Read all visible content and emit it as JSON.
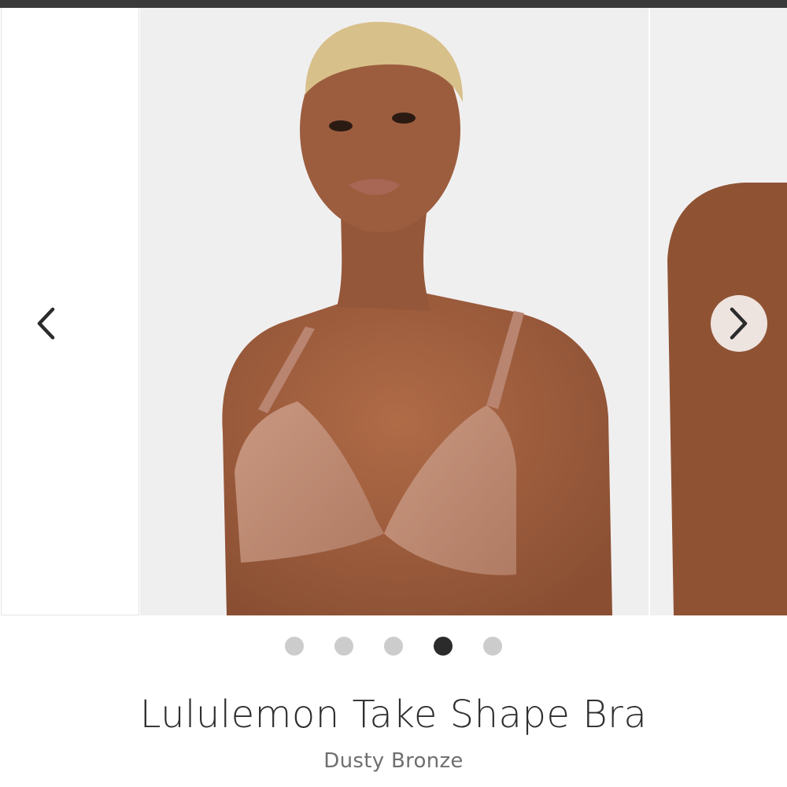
{
  "carousel": {
    "dots": [
      {
        "active": false
      },
      {
        "active": false
      },
      {
        "active": false
      },
      {
        "active": true
      },
      {
        "active": false
      }
    ],
    "prev_icon": "chevron-left-icon",
    "next_icon": "chevron-right-icon"
  },
  "product": {
    "title": "Lululemon Take Shape Bra",
    "color_name": "Dusty Bronze"
  },
  "colors": {
    "top_bar": "#3a3a3a",
    "dot_inactive": "#cccccc",
    "dot_active": "#2b2b2b",
    "bra": "#c08a72",
    "skin": "#9a5b3c",
    "hair": "#d8c08a"
  }
}
